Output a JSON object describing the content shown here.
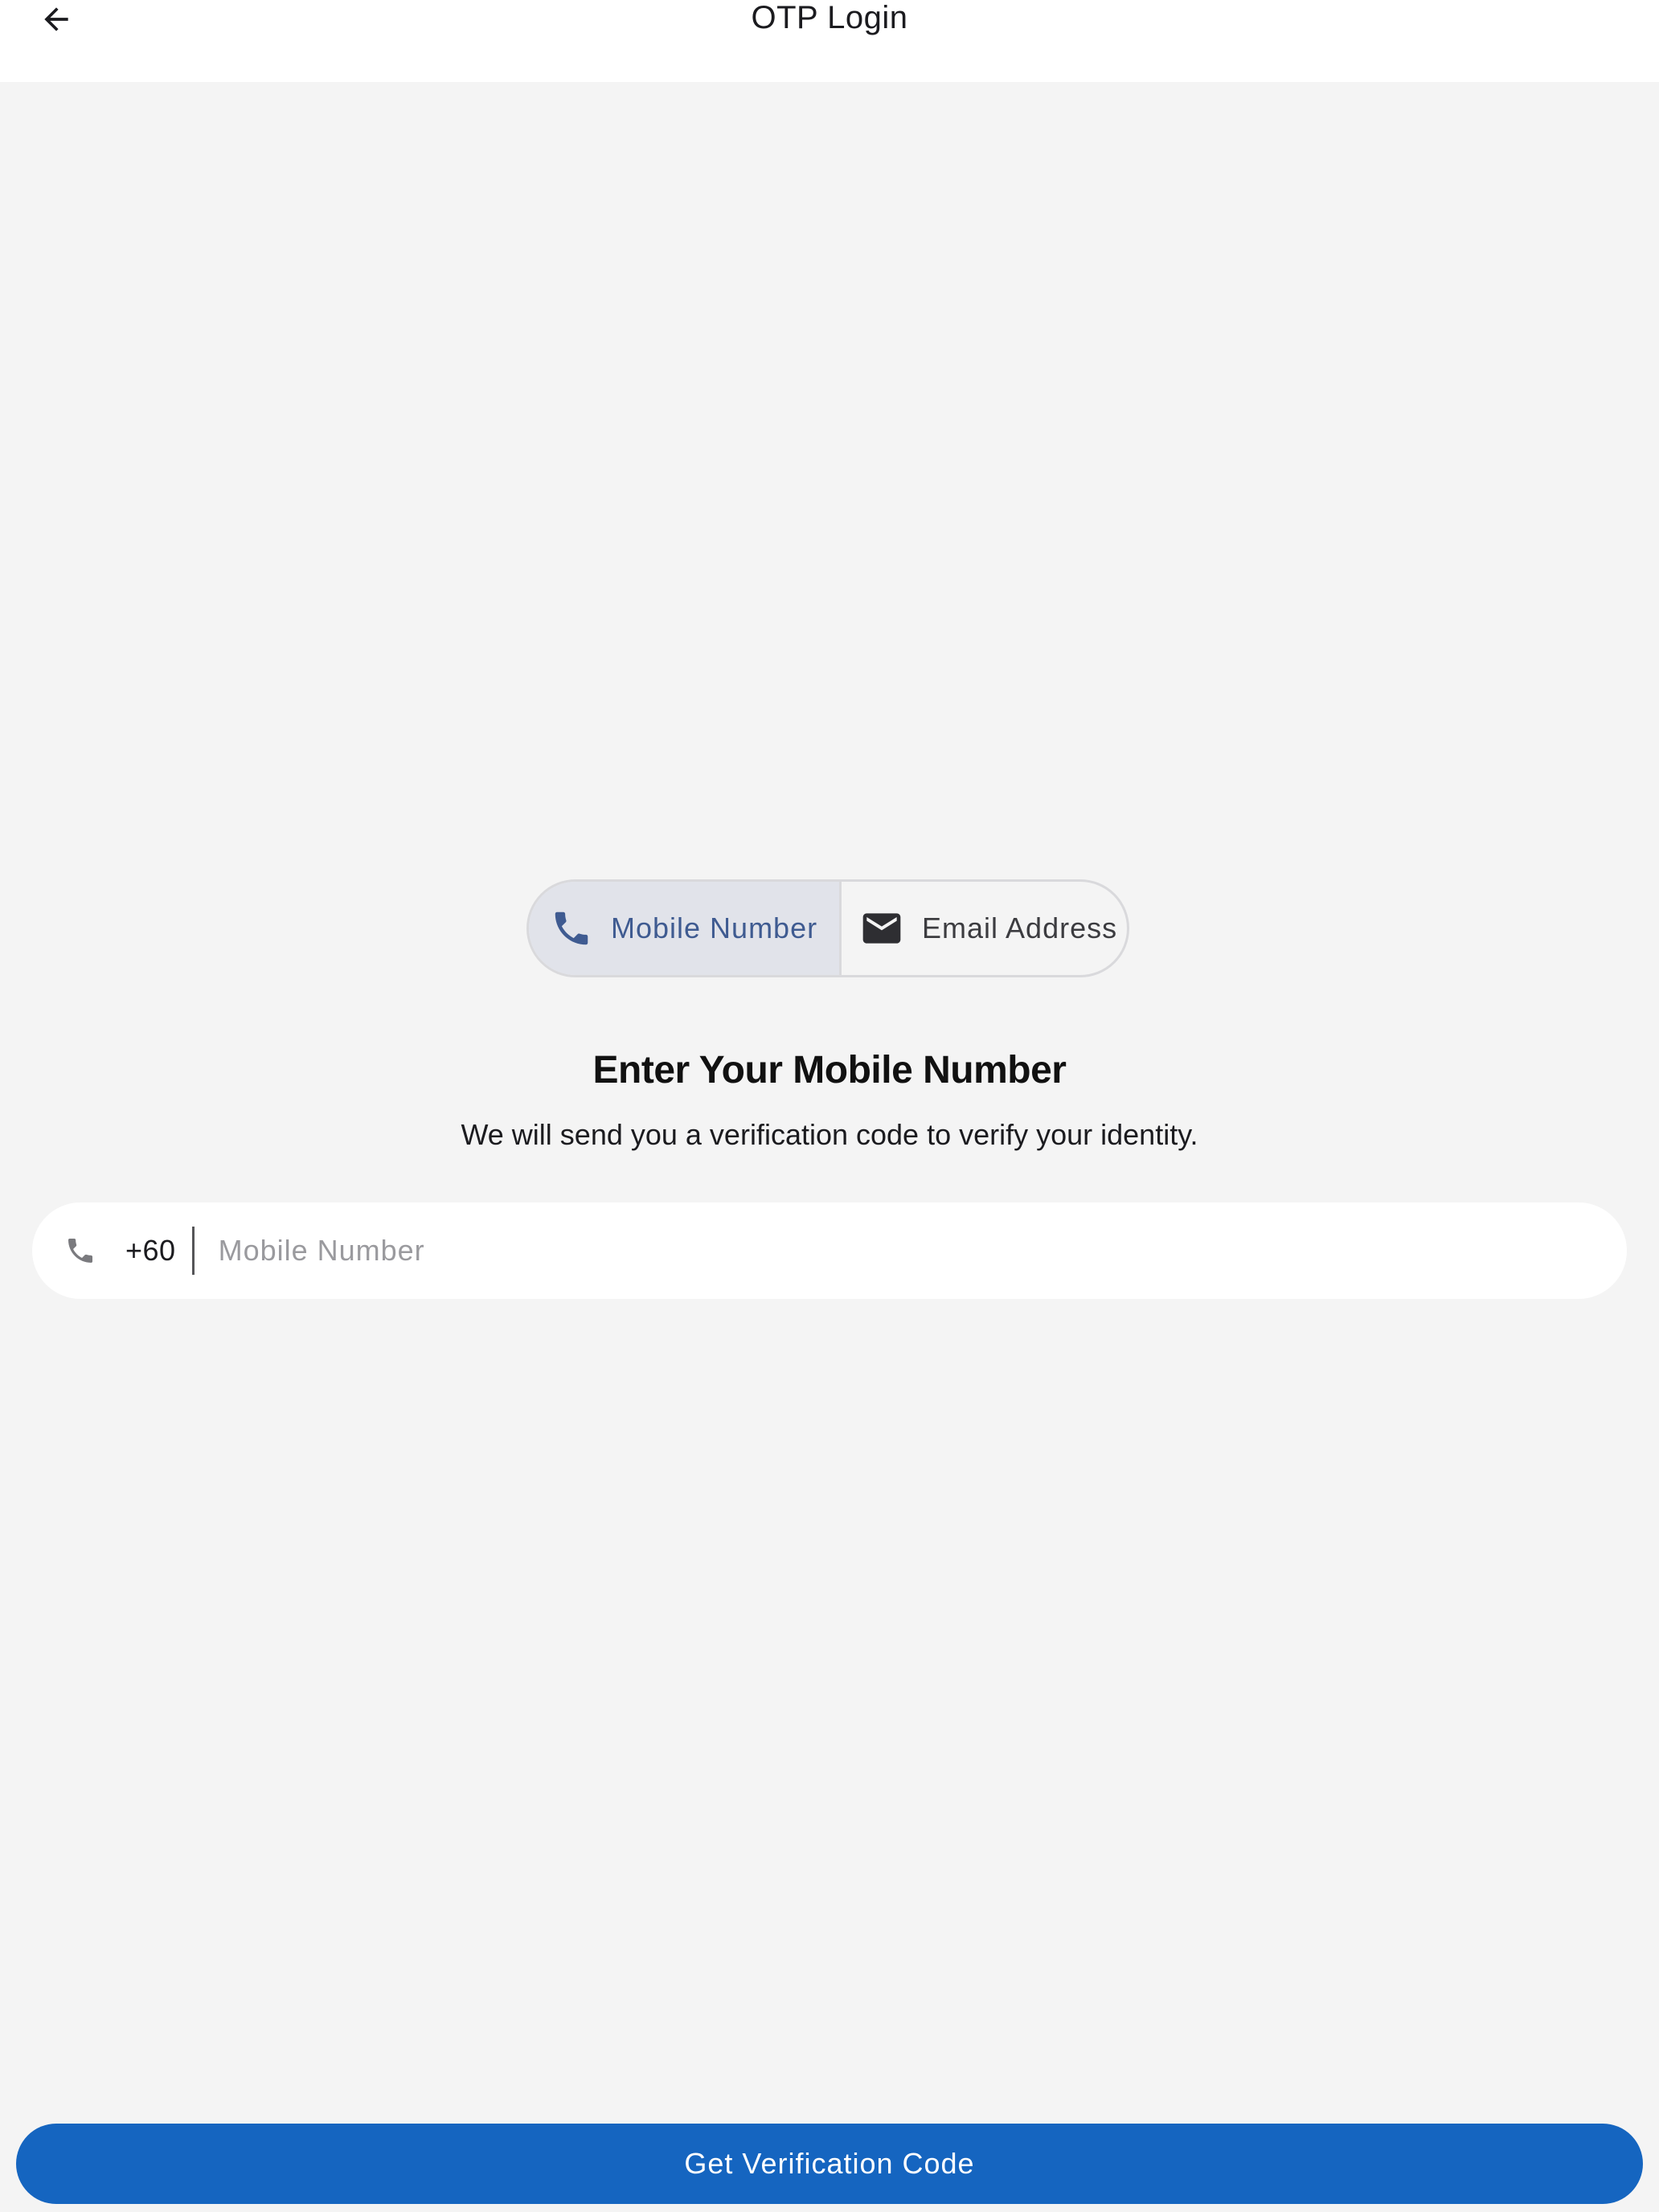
{
  "app_bar": {
    "title": "OTP Login",
    "back_icon": "arrow-back-icon"
  },
  "login_method": {
    "options": [
      {
        "label": "Mobile Number",
        "icon": "phone-icon",
        "selected": true
      },
      {
        "label": "Email Address",
        "icon": "mail-icon",
        "selected": false
      }
    ]
  },
  "main": {
    "heading": "Enter Your Mobile Number",
    "subheading": "We will send you a verification code to verify your identity."
  },
  "phone_field": {
    "icon": "phone-icon",
    "country_code": "+60",
    "value": "",
    "placeholder": "Mobile Number"
  },
  "cta": {
    "label": "Get Verification Code"
  },
  "colors": {
    "primary": "#1565c0",
    "selected_segment_bg": "#e1e3ea",
    "selected_segment_text": "#3f5b91",
    "background": "#f4f4f4"
  }
}
